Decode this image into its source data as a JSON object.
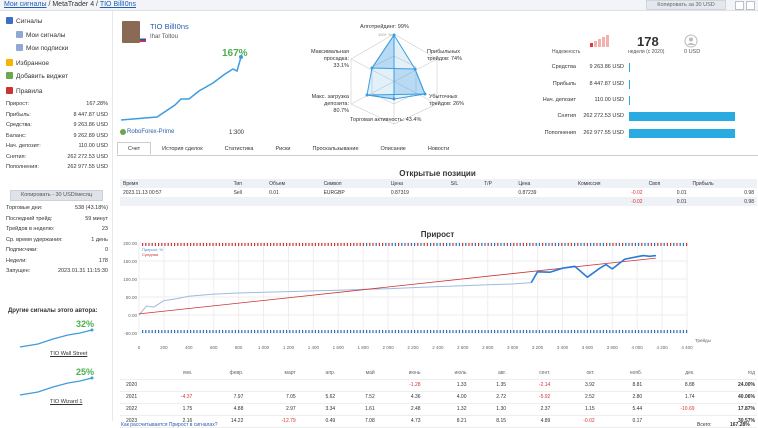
{
  "breadcrumb": {
    "root": "Мои сигналы",
    "mid": "MetaTrader 4",
    "current": "TIO BillI0ns"
  },
  "topbar": {
    "copy_label": "Копировать за 30 USD"
  },
  "sidebar": {
    "nav": [
      {
        "label": "Сигналы",
        "icon": "signals-icon",
        "color": "#3b6fc6"
      },
      {
        "label": "Мои сигналы",
        "icon": "my-signals-icon",
        "color": "#8fa8d6"
      },
      {
        "label": "Мои подписки",
        "icon": "subscriptions-icon",
        "color": "#8fa8d6"
      },
      {
        "label": "Избранное",
        "icon": "star-icon",
        "color": "#f5b400"
      },
      {
        "label": "Добавить виджет",
        "icon": "widget-icon",
        "color": "#6aa84f"
      },
      {
        "label": "Правила",
        "icon": "rules-icon",
        "color": "#cc3333"
      }
    ],
    "stats": [
      {
        "k": "Прирост:",
        "v": "167.28%"
      },
      {
        "k": "Прибыль:",
        "v": "8 447.87 USD"
      },
      {
        "k": "Средства:",
        "v": "9 263.86 USD"
      },
      {
        "k": "Баланс:",
        "v": "9 262.89 USD"
      },
      {
        "k": "Нач. депозит:",
        "v": "110.00 USD"
      },
      {
        "k": "Снятия:",
        "v": "262 272.53 USD"
      },
      {
        "k": "Пополнения:",
        "v": "262 977.55 USD"
      }
    ],
    "copy_label": "Копировать - 30 USD/месяц",
    "stats2": [
      {
        "k": "Торговые дни:",
        "v": "538 (43.18%)"
      },
      {
        "k": "Последний трейд:",
        "v": "59 минут"
      },
      {
        "k": "Трейдов в неделю:",
        "v": "23"
      },
      {
        "k": "Ср. время удержания:",
        "v": "1 день"
      },
      {
        "k": "Подписчики:",
        "v": "0"
      },
      {
        "k": "Недели:",
        "v": "178"
      },
      {
        "k": "Запущен:",
        "v": "2023.01.31 11:15:30"
      }
    ],
    "other_title": "Другие сигналы этого автора:",
    "other": [
      {
        "name": "TIO Wall Street",
        "pct": "32%"
      },
      {
        "name": "TIO Wizard 1",
        "pct": "25%"
      }
    ]
  },
  "header": {
    "name": "TIO BillI0ns",
    "author": "Ihar Toltou",
    "growth": "167%",
    "broker": "RoboForex-Prime",
    "leverage": "1:300"
  },
  "radar": {
    "algo": "Алготрейдинг: 99%",
    "drawdown_a": "Максимальная",
    "drawdown_b": "просадка: 33.1%",
    "profit_a": "Прибыльных",
    "profit_b": "трейдов: 74%",
    "load_a": "Макс. загрузка",
    "load_b": "депозита: 80.7%",
    "loss_a": "Убыточных",
    "loss_b": "трейдов: 26%",
    "activity": "Торговая активность: 43.4%",
    "ring": "100+ %"
  },
  "reliability_label": "Надежность",
  "weeks": {
    "value": "178",
    "label": "недели (с 2020)",
    "usd": "0 USD"
  },
  "stats_panel": [
    {
      "k": "Средства",
      "v": "9 263.86 USD",
      "bar": 0.005
    },
    {
      "k": "Прибыль",
      "v": "8 447.87 USD",
      "bar": 0.005
    },
    {
      "k": "Нач. депозит",
      "v": "110.00 USD",
      "bar": 0.005
    },
    {
      "k": "Снятия",
      "v": "262 272.53 USD",
      "bar": 0.997
    },
    {
      "k": "Пополнения",
      "v": "262 977.55 USD",
      "bar": 1.0
    }
  ],
  "tabs": [
    "Счет",
    "История сделок",
    "Статистика",
    "Риски",
    "Проскальзывание",
    "Описание",
    "Новости"
  ],
  "positions": {
    "title": "Открытые позиции",
    "headers": [
      "Время",
      "Тип",
      "Объем",
      "Символ",
      "Цена",
      "S/L",
      "T/P",
      "Цена",
      "Комиссия",
      "Своп",
      "Прибыль"
    ],
    "row": [
      "2023.11.13 00:57",
      "Sell",
      "0.01",
      "EURGBP",
      "0.87319",
      "",
      "",
      "0.87239",
      "-0.02",
      "0.01",
      "0.98"
    ],
    "total": [
      "-0.02",
      "0.01",
      "0.98"
    ]
  },
  "growth_title": "Прирост",
  "chart_data": {
    "type": "line",
    "legend": [
      "Прирост, %",
      "Средняя"
    ],
    "x_ticks": [
      "0",
      "200",
      "400",
      "600",
      "800",
      "1 000",
      "1 200",
      "1 400",
      "1 600",
      "1 800",
      "2 000",
      "2 200",
      "2 400",
      "2 600",
      "2 800",
      "3 000",
      "3 200",
      "3 400",
      "3 600",
      "3 800",
      "4 000",
      "4 200",
      "4 400"
    ],
    "y_ticks": [
      "200.00",
      "150.00",
      "100.00",
      "50.00",
      "0.00",
      "-50.00"
    ],
    "xlabel": "Трейды",
    "ylim": [
      -50,
      200
    ],
    "xlim": [
      0,
      4400
    ],
    "series": [
      {
        "name": "Прирост, %",
        "x": [
          0,
          60,
          120,
          200,
          300,
          400,
          600,
          800,
          1000,
          1200,
          1400,
          1600,
          1800,
          2000,
          2200,
          2400,
          2600,
          2800,
          3000,
          3150,
          3200,
          3300,
          3400,
          3500,
          3600,
          3700,
          3750,
          3800,
          3900,
          4000,
          4050,
          4100,
          4150
        ],
        "y": [
          0,
          25,
          22,
          40,
          45,
          52,
          58,
          61,
          63,
          65,
          67,
          69,
          71,
          73,
          76,
          79,
          81,
          84,
          86,
          90,
          120,
          119,
          130,
          135,
          105,
          130,
          140,
          128,
          155,
          162,
          165,
          163,
          165
        ]
      },
      {
        "name": "Средняя",
        "x": [
          0,
          4150
        ],
        "y": [
          3,
          158
        ]
      }
    ]
  },
  "monthly": {
    "months": [
      "янв.",
      "февр.",
      "март",
      "апр.",
      "май",
      "июнь",
      "июль",
      "авг.",
      "сент.",
      "окт.",
      "нояб.",
      "дек.",
      "год"
    ],
    "rows": [
      {
        "year": "2020",
        "vals": [
          "",
          "",
          "",
          "",
          "",
          "-1.28",
          "1.33",
          "1.35",
          "-2.14",
          "3.92",
          "8.81",
          "8.88",
          "24.00%"
        ]
      },
      {
        "year": "2021",
        "vals": [
          "-4.37",
          "7.97",
          "7.05",
          "5.62",
          "7.52",
          "4.36",
          "4.00",
          "2.72",
          "-5.92",
          "2.52",
          "2.80",
          "1.74",
          "40.06%"
        ]
      },
      {
        "year": "2022",
        "vals": [
          "1.75",
          "4.88",
          "2.97",
          "3.34",
          "1.61",
          "2.48",
          "1.32",
          "1.30",
          "2.37",
          "1.15",
          "5.44",
          "-10.69",
          "17.87%"
        ]
      },
      {
        "year": "2023",
        "vals": [
          "2.16",
          "14.22",
          "-12.79",
          "0.49",
          "7.08",
          "4.73",
          "8.21",
          "8.15",
          "4.89",
          "-0.02",
          "0.17",
          "",
          "30.57%"
        ]
      }
    ],
    "calc_link": "Как рассчитывается Прирост в сигналах?",
    "total_label": "Всего:",
    "total_value": "167.28%"
  }
}
